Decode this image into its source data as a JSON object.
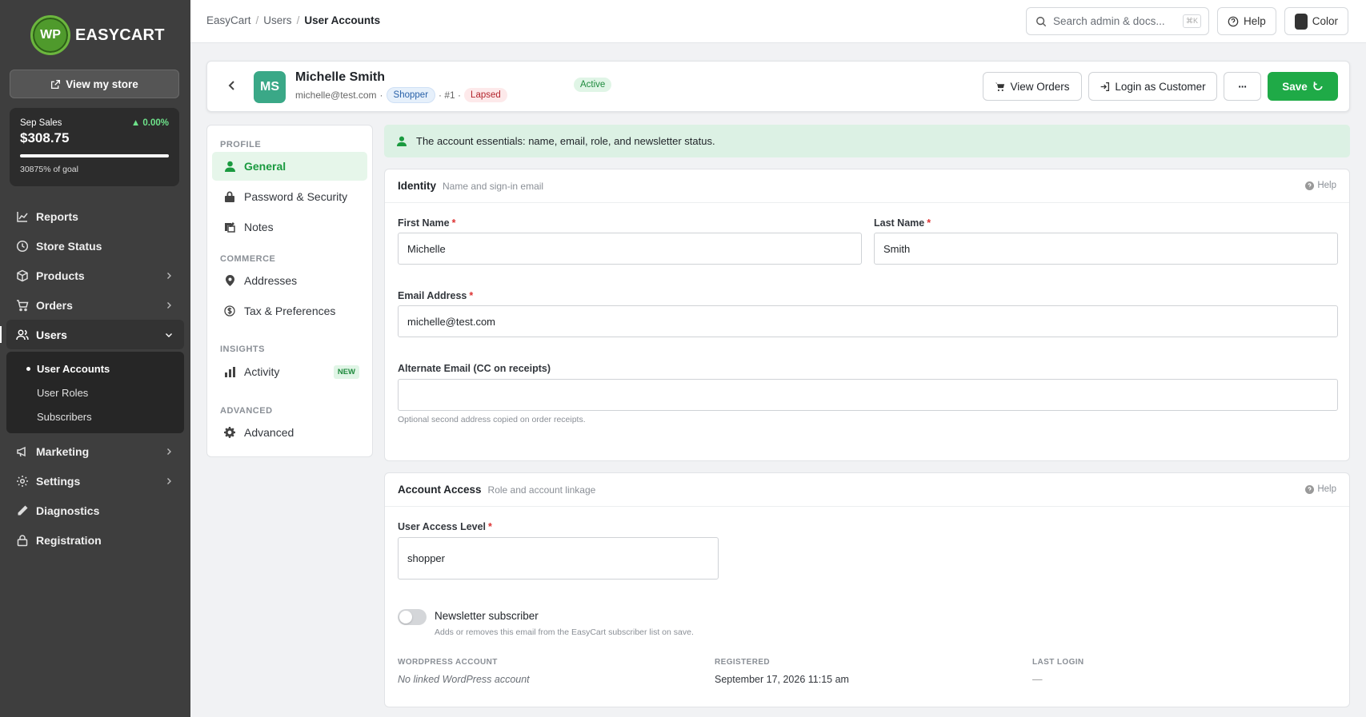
{
  "brand": {
    "logo_text": "WP",
    "name": "EASYCART"
  },
  "sidebar": {
    "view_store_label": "View my store",
    "sales": {
      "label": "Sep Sales",
      "delta": "▲ 0.00%",
      "amount": "$308.75",
      "goal": "30875% of goal",
      "progress": 1.0
    },
    "items": [
      {
        "label": "Reports",
        "icon": "chart-line-icon",
        "chevron": false
      },
      {
        "label": "Store Status",
        "icon": "clock-icon",
        "chevron": false
      },
      {
        "label": "Products",
        "icon": "box-icon",
        "chevron": true
      },
      {
        "label": "Orders",
        "icon": "cart-icon",
        "chevron": true
      },
      {
        "label": "Users",
        "icon": "users-icon",
        "chevron": true,
        "expanded": true
      },
      {
        "label": "Marketing",
        "icon": "megaphone-icon",
        "chevron": true
      },
      {
        "label": "Settings",
        "icon": "gear-icon",
        "chevron": true
      },
      {
        "label": "Diagnostics",
        "icon": "pencil-icon",
        "chevron": false
      },
      {
        "label": "Registration",
        "icon": "lock-icon",
        "chevron": false
      }
    ],
    "users_sub": [
      "User Accounts",
      "User Roles",
      "Subscribers"
    ]
  },
  "topbar": {
    "breadcrumb": [
      "EasyCart",
      "Users",
      "User Accounts"
    ],
    "search_placeholder": "Search admin & docs...",
    "search_kbd": "⌘K",
    "help_label": "Help",
    "color_label": "Color"
  },
  "user": {
    "initials": "MS",
    "name": "Michelle Smith",
    "email": "michelle@test.com",
    "role_badge": "Shopper",
    "number": "· #1 ·",
    "lapsed_badge": "Lapsed",
    "status": "Active"
  },
  "actions": {
    "view_orders": "View Orders",
    "login_as": "Login as Customer",
    "more": "···",
    "save": "Save"
  },
  "menu": {
    "sections": {
      "profile": "PROFILE",
      "commerce": "COMMERCE",
      "insights": "INSIGHTS",
      "advanced": "ADVANCED"
    },
    "items": {
      "general": "General",
      "password": "Password & Security",
      "notes": "Notes",
      "addresses": "Addresses",
      "tax": "Tax & Preferences",
      "activity": "Activity",
      "activity_badge": "NEW",
      "advanced": "Advanced"
    }
  },
  "banner": "The account essentials: name, email, role, and newsletter status.",
  "identity": {
    "title": "Identity",
    "subtitle": "Name and sign-in email",
    "help": "Help",
    "first_name_label": "First Name",
    "first_name": "Michelle",
    "last_name_label": "Last Name",
    "last_name": "Smith",
    "email_label": "Email Address",
    "email": "michelle@test.com",
    "alt_email_label": "Alternate Email (CC on receipts)",
    "alt_email": "",
    "alt_email_hint": "Optional second address copied on order receipts.",
    "required_mark": "*"
  },
  "access": {
    "title": "Account Access",
    "subtitle": "Role and account linkage",
    "help": "Help",
    "level_label": "User Access Level",
    "level": "shopper",
    "newsletter_label": "Newsletter subscriber",
    "newsletter_hint": "Adds or removes this email from the EasyCart subscriber list on save.",
    "newsletter_on": false,
    "wp_label": "WORDPRESS ACCOUNT",
    "wp_value": "No linked WordPress account",
    "registered_label": "REGISTERED",
    "registered_value": "September 17, 2026 11:15 am",
    "last_login_label": "LAST LOGIN",
    "last_login_value": "—"
  },
  "colors": {
    "accent": "#1faa47",
    "sidebar": "#3e3e3e",
    "avatar": "#3aa887"
  }
}
